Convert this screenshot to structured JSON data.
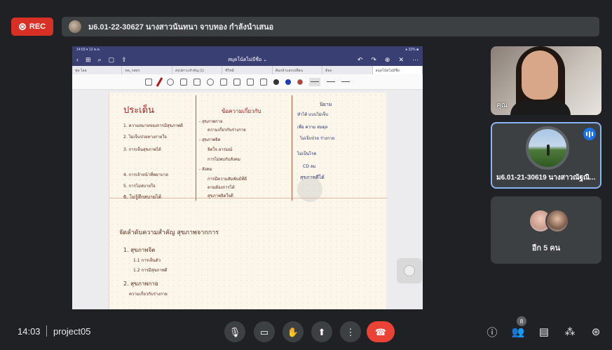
{
  "recording": {
    "label": "REC"
  },
  "presenter": {
    "text": "ม6.01-22-30627 นางสาวนันทนา จาบทอง กำลังนำเสนอ"
  },
  "shared_screen": {
    "status_time": "14:03  ▾ 12 ต.ค.",
    "status_battery": "● 32% ■",
    "doc_title": "สมุดโน้ตไม่มีชื่อ ⌄",
    "tabs": [
      "ชุด ไลอ",
      "ทล_กสทร",
      "สรุปสาระสำคัญ (1)",
      "ซีวิทย์",
      "ต้นกล้าแลกเปลี่ยน",
      "ต้อถ",
      "สมุดโน้ตไม่มีชื่อ"
    ],
    "notes": {
      "heading_left": "ประเด็น",
      "left_items": [
        "1. ความหมายของการมีสุขภาพดี",
        "2. ไม่เจ็บป่วยทางกายใจ",
        "3. การเห็นสุขภาพได้",
        "4. การเจ้าหน้าที่พยาบาล",
        "5. การไม่สบายใจ",
        "6. ไม่รู้สึกสบายได้"
      ],
      "heading_mid": "ข้อความเกี่ยวกับ",
      "mid_items": [
        "- สุขภาพกาย",
        "ความเกี่ยวกับร่างกาย",
        "- สุขภาพจิต",
        "จิตใจ อารมณ์",
        "การไม่พบกับสังคม",
        "- สังคม",
        "การมีความสัมพันธ์ที่ดี",
        "ตามต้องการได้",
        "สุขภาพจิตใจดี"
      ],
      "heading_right": "นิยาม",
      "right_items": [
        "ทำได้ แบบไม่เจ็บ",
        "เพื่อ ความ สมดุล",
        "ไม่เจ็บป่วย ร่างกาย",
        "ไม่เป็นโรค",
        "CD ลม",
        "สุขภาพดีได้"
      ],
      "lower_title": "จัดลำดับความสำคัญ สุขภาพจากการ",
      "lower_items": [
        "1. สุขภาพจิต",
        "1.1 การเห็นตัว",
        "1.2 การมีสุขภาพดี",
        "2. สุขภาพกาย",
        "ความเกี่ยวกับร่างกาย"
      ]
    }
  },
  "tiles": {
    "self": {
      "name": "คุณ"
    },
    "speaker": {
      "name": "ม6.01-21-30619 นางสาวณัฐณิ..."
    },
    "others": {
      "label": "อีก 5 คน"
    }
  },
  "bottom": {
    "time": "14:03",
    "meeting_code": "project05",
    "participants_count": "8",
    "end_color": "#ea4335"
  }
}
